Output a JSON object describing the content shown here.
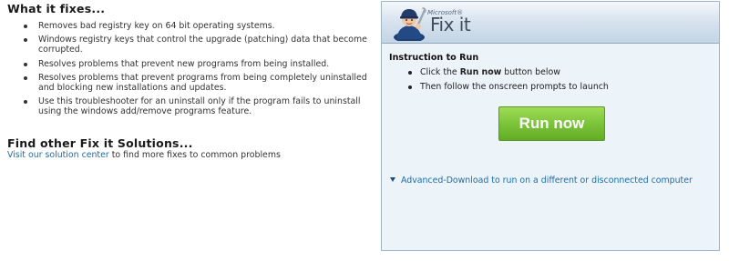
{
  "what_fixes": {
    "title": "What it fixes...",
    "items": [
      "Removes bad registry key on 64 bit operating systems.",
      "Windows registry keys that control the upgrade (patching) data that become corrupted.",
      "Resolves problems that prevent new programs from being installed.",
      "Resolves problems that prevent programs from being completely uninstalled and blocking new installations and updates.",
      "Use this troubleshooter for an uninstall only if the program fails to uninstall using the windows add/remove programs feature."
    ]
  },
  "find_other": {
    "title": "Find other Fix it Solutions...",
    "link_text": "Visit our solution center",
    "rest_text": " to find more fixes to common problems"
  },
  "panel": {
    "logo_brand": "Microsoft®",
    "logo_name": "Fix it",
    "logo_icon": "mechanic-with-wrench-icon",
    "instruction_title": "Instruction to Run",
    "step1_prefix": "Click the ",
    "step1_bold": "Run now",
    "step1_suffix": " button below",
    "step2": "Then follow the onscreen prompts to launch",
    "run_button_label": "Run now",
    "advanced_link": "Advanced-Download to run on a different or disconnected computer"
  },
  "colors": {
    "link": "#1a6ea8",
    "run_button": "#7cc43a",
    "panel_bg": "#ecf3f9"
  }
}
